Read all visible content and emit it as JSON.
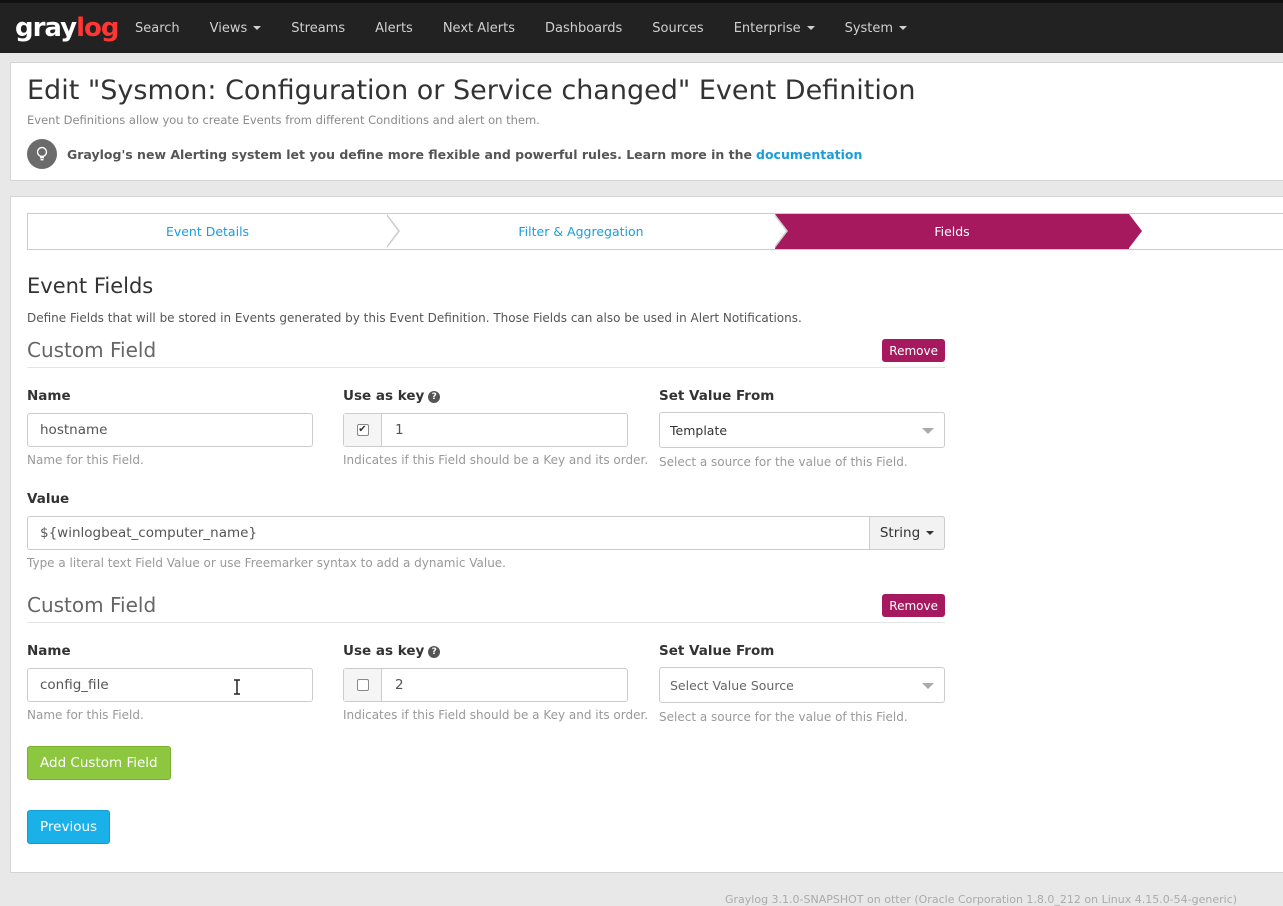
{
  "navbar": {
    "logo_part1": "gray",
    "logo_part2": "log",
    "items": [
      {
        "label": "Search",
        "dropdown": false
      },
      {
        "label": "Views",
        "dropdown": true
      },
      {
        "label": "Streams",
        "dropdown": false
      },
      {
        "label": "Alerts",
        "dropdown": false
      },
      {
        "label": "Next Alerts",
        "dropdown": false
      },
      {
        "label": "Dashboards",
        "dropdown": false
      },
      {
        "label": "Sources",
        "dropdown": false
      },
      {
        "label": "Enterprise",
        "dropdown": true
      },
      {
        "label": "System",
        "dropdown": true
      }
    ]
  },
  "header": {
    "title": "Edit \"Sysmon: Configuration or Service changed\" Event Definition",
    "subtitle": "Event Definitions allow you to create Events from different Conditions and alert on them.",
    "info_text": "Graylog's new Alerting system let you define more flexible and powerful rules. Learn more in the",
    "info_link": "documentation",
    "info_icon": "lightbulb-icon"
  },
  "wizard": {
    "steps": [
      "Event Details",
      "Filter & Aggregation",
      "Fields"
    ],
    "active_step": "Fields"
  },
  "fields_section": {
    "title": "Event Fields",
    "description": "Define Fields that will be stored in Events generated by this Event Definition. Those Fields can also be used in Alert Notifications."
  },
  "custom_fields": [
    {
      "title": "Custom Field",
      "remove_label": "Remove",
      "name_label": "Name",
      "name_value": "hostname",
      "name_help": "Name for this Field.",
      "key_label": "Use as key",
      "key_checked": true,
      "key_value": "1",
      "key_help": "Indicates if this Field should be a Key and its order.",
      "source_label": "Set Value From",
      "source_value": "Template",
      "source_help": "Select a source for the value of this Field.",
      "value_label": "Value",
      "value_value": "${winlogbeat_computer_name}",
      "value_type": "String",
      "value_help": "Type a literal text Field Value or use Freemarker syntax to add a dynamic Value."
    },
    {
      "title": "Custom Field",
      "remove_label": "Remove",
      "name_label": "Name",
      "name_value": "config_file",
      "name_help": "Name for this Field.",
      "key_label": "Use as key",
      "key_checked": false,
      "key_value": "2",
      "key_help": "Indicates if this Field should be a Key and its order.",
      "source_label": "Set Value From",
      "source_placeholder": "Select Value Source",
      "source_help": "Select a source for the value of this Field."
    }
  ],
  "buttons": {
    "add_custom_field": "Add Custom Field",
    "previous": "Previous"
  },
  "footer": {
    "text": "Graylog 3.1.0-SNAPSHOT on otter (Oracle Corporation 1.8.0_212 on Linux 4.15.0-54-generic)"
  },
  "colors": {
    "navbar_bg": "#222222",
    "brand_red": "#ff3633",
    "active_step": "#a6195f",
    "link": "#1a9ed9",
    "success": "#8dc63f",
    "primary": "#1ab0e8"
  }
}
